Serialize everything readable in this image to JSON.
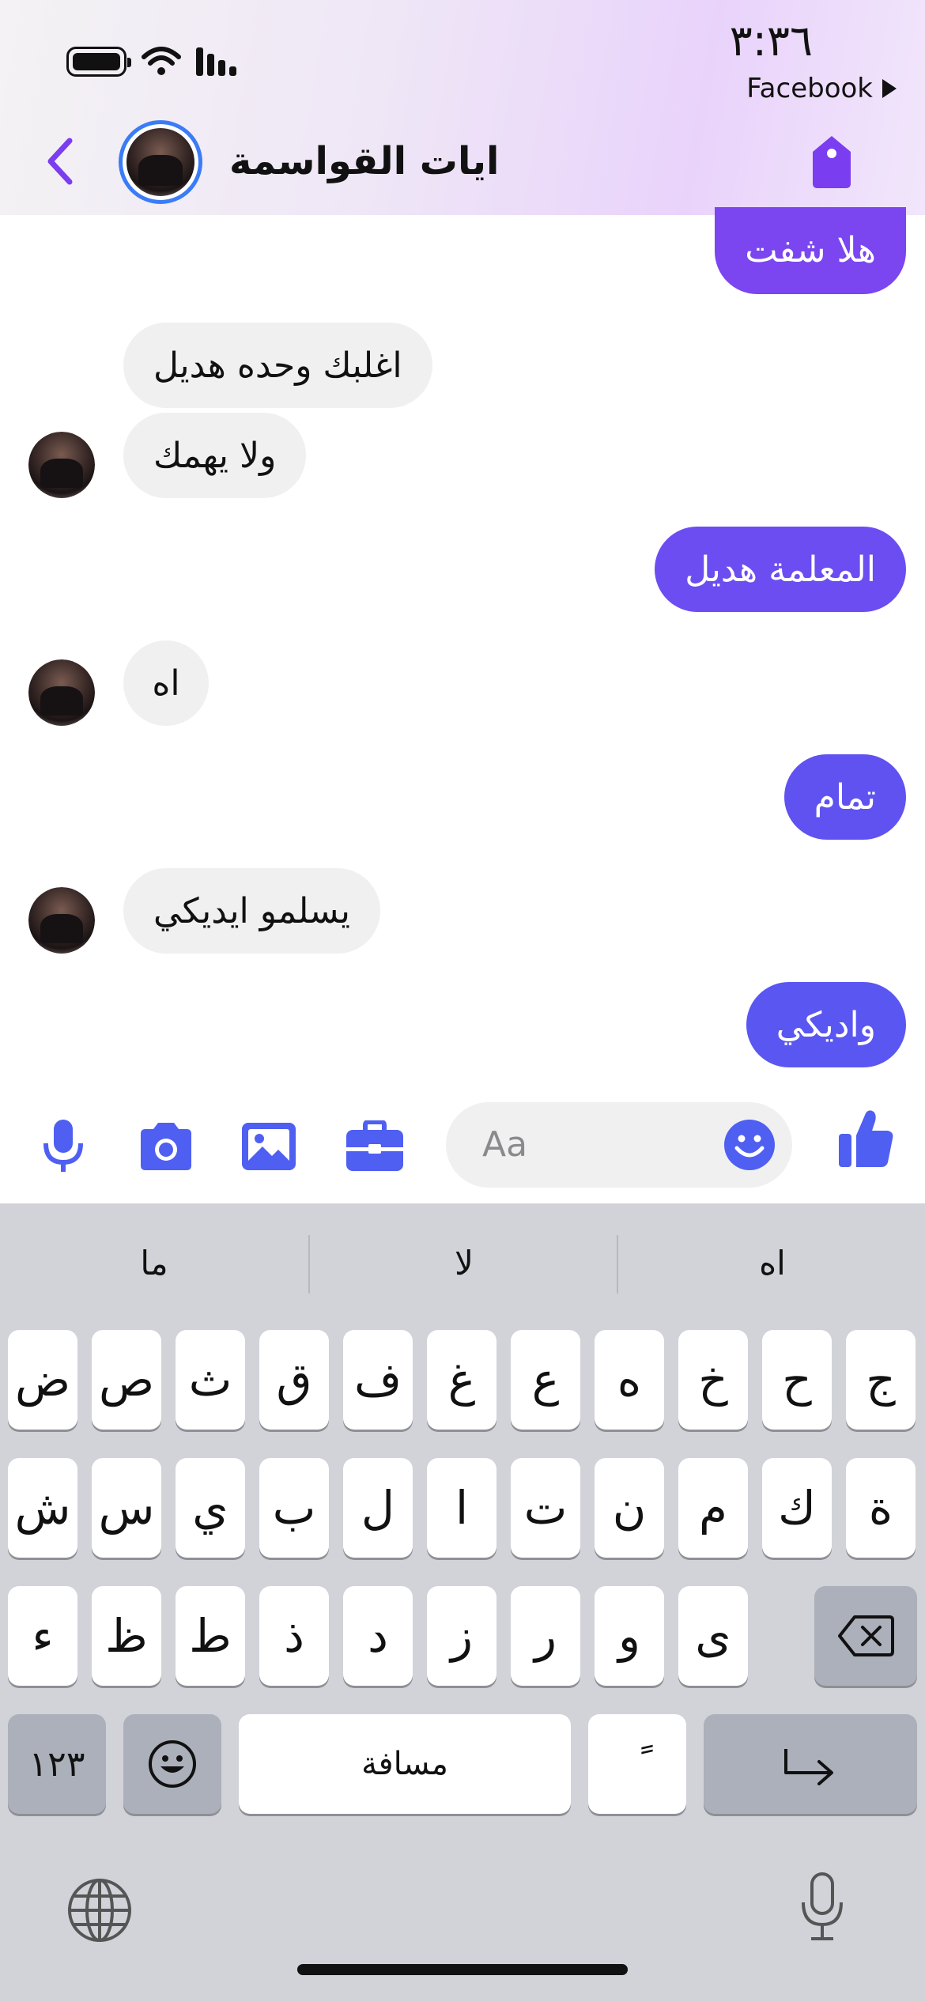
{
  "status": {
    "time": "٣:٣٦",
    "back_app": "Facebook",
    "icons": [
      "battery-icon",
      "wifi-icon",
      "signal-icon"
    ]
  },
  "chat": {
    "name": "ايات القواسمة",
    "colors": {
      "accent": "#7a3df0",
      "outgoing_top": "#7a3df0",
      "outgoing_bottom": "#5b55f1",
      "incoming": "#f0f0f0",
      "avatar_ring": "#3b7cf6"
    }
  },
  "messages": [
    {
      "text": "هلا شفت",
      "from": "me",
      "color": "#7b45f0"
    },
    {
      "text": "اغلبك وحده هديل",
      "from": "them"
    },
    {
      "text": "ولا يهمك",
      "from": "them"
    },
    {
      "text": "المعلمة هديل",
      "from": "me",
      "color": "#6c4df1"
    },
    {
      "text": "اه",
      "from": "them"
    },
    {
      "text": "تمام",
      "from": "me",
      "color": "#5f52f1"
    },
    {
      "text": "يسلمو ايديكي",
      "from": "them"
    },
    {
      "text": "واديكي",
      "from": "me",
      "color": "#5a56f1"
    }
  ],
  "composer": {
    "placeholder": "Aa",
    "tools": [
      "microphone-icon",
      "camera-icon",
      "image-icon",
      "briefcase-icon"
    ],
    "color": "#4f5ff2"
  },
  "keyboard": {
    "suggestions": [
      "ما",
      "لا",
      "اه"
    ],
    "row1": [
      "ض",
      "ص",
      "ث",
      "ق",
      "ف",
      "غ",
      "ع",
      "ه",
      "خ",
      "ح",
      "ج"
    ],
    "row2": [
      "ش",
      "س",
      "ي",
      "ب",
      "ل",
      "ا",
      "ت",
      "ن",
      "م",
      "ك",
      "ة"
    ],
    "row3": [
      "ء",
      "ظ",
      "ط",
      "ذ",
      "د",
      "ز",
      "ر",
      "و",
      "ى"
    ],
    "numbers_label": "١٢٣",
    "space_label": "مسافة",
    "diacritic_label": "ً"
  }
}
